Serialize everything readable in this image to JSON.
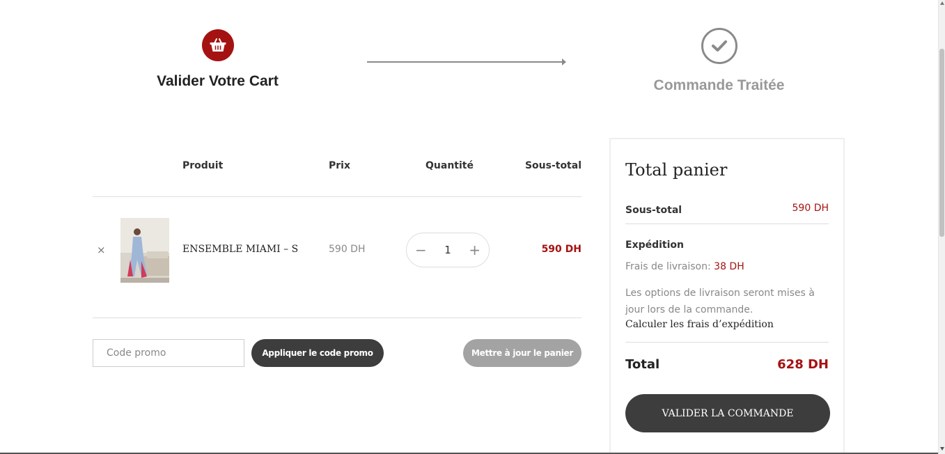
{
  "steps": {
    "step1_label": "Valider Votre Cart",
    "step1_icon": "basket-icon",
    "step2_label": "Commande Traitée",
    "step2_icon": "checkmark-icon"
  },
  "cart": {
    "headers": {
      "product": "Produit",
      "price": "Prix",
      "quantity": "Quantité",
      "subtotal": "Sous-total"
    },
    "items": [
      {
        "remove": "×",
        "name": "ENSEMBLE MIAMI – S",
        "price": "590 DH",
        "quantity": "1",
        "minus": "−",
        "plus": "+",
        "subtotal": "590 DH"
      }
    ],
    "coupon_placeholder": "Code promo",
    "apply_label": "Appliquer le code promo",
    "update_label": "Mettre à jour le panier"
  },
  "totals": {
    "title": "Total panier",
    "subtotal_label": "Sous-total",
    "subtotal_value": "590 DH",
    "shipping_label": "Expédition",
    "shipping_fee_label": "Frais de livraison:",
    "shipping_fee_value": "38 DH",
    "shipping_note": "Les options de livraison seront mises à jour lors de la commande.",
    "calc_link": "Calculer les frais d’expédition",
    "total_label": "Total",
    "total_value": "628 DH",
    "checkout_label": "VALIDER LA COMMANDE"
  },
  "colors": {
    "accent": "#a51212",
    "dark_button": "#3d3d3d",
    "disabled_button": "#a3a3a3"
  }
}
